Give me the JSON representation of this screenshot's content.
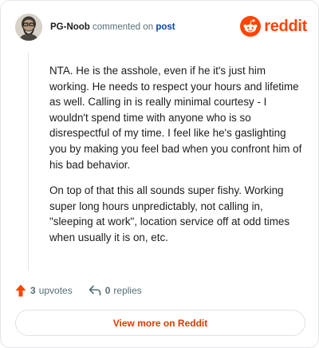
{
  "header": {
    "author": "PG-Noob",
    "action_text": "commented on",
    "post_link": "post",
    "brand_name": "reddit",
    "avatar_icon": "bearded-man-avatar",
    "brand_icon": "reddit-alien-icon",
    "brand_color": "#ff4500"
  },
  "comment": {
    "paragraphs": [
      "NTA. He is the asshole, even if he it's just him working. He needs to respect your hours and lifetime as well. Calling in is really minimal courtesy - I wouldn't spend time with anyone who is so disrespectful of my time. I feel like he's gaslighting you by making you feel bad when you confront him of his bad behavior.",
      "On top of that this all sounds super fishy. Working super long hours unpredictably, not calling in, \"sleeping at work\", location service off at odd times when usually it is on, etc."
    ]
  },
  "footer": {
    "upvote_count": "3",
    "upvote_label": "upvotes",
    "reply_count": "0",
    "reply_label": "replies",
    "upvote_icon": "upvote-arrow-icon",
    "reply_icon": "reply-arrow-icon",
    "upvote_color": "#ff4500"
  },
  "cta": {
    "view_more_label": "View more on Reddit",
    "link_color": "#d93a00"
  }
}
